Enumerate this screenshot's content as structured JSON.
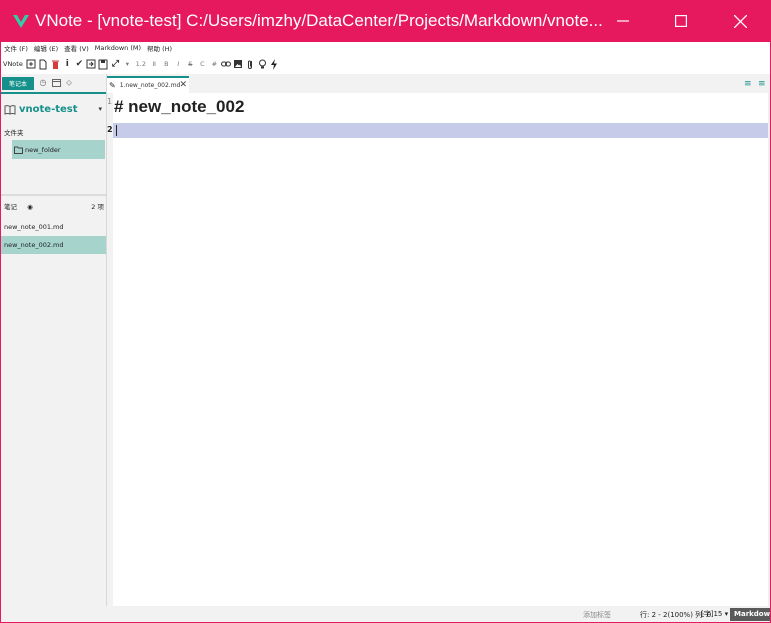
{
  "window": {
    "title": "VNote - [vnote-test] C:/Users/imzhy/DataCenter/Projects/Markdown/vnote...",
    "accent": "#e6185e",
    "controls": {
      "minimize": "minimize-icon",
      "maximize": "maximize-icon",
      "close": "close-icon"
    }
  },
  "menubar": {
    "items": [
      "文件 (F)",
      "编辑 (E)",
      "查看 (V)",
      "Markdown (M)",
      "帮助 (H)"
    ]
  },
  "toolbar": {
    "label": "VNote",
    "heading_level": "1.2",
    "bold": "B",
    "italic": "I",
    "strike": "S",
    "code": "C",
    "hash": "#",
    "info": "i"
  },
  "left_panel": {
    "tab_active": "笔记本",
    "notebook": "vnote-test",
    "folders_label": "文件夹",
    "folders": [
      "new_folder"
    ],
    "notes_label": "笔记",
    "notes_count": "2 项",
    "notes": [
      "new_note_001.md",
      "new_note_002.md"
    ],
    "accent": "#15908a",
    "selection": "#a6d4cd"
  },
  "editor": {
    "tab_label": "1.new_note_002.md",
    "lines": [
      "# new_note_002",
      ""
    ],
    "line_numbers": [
      "1",
      "2"
    ],
    "current_line_color": "#c5cbe9"
  },
  "statusbar": {
    "tag": "添加标签",
    "position": "行: 2 - 2(100%) 列: 0",
    "word_count": "[字]15 ▾",
    "mode": "Markdown"
  }
}
